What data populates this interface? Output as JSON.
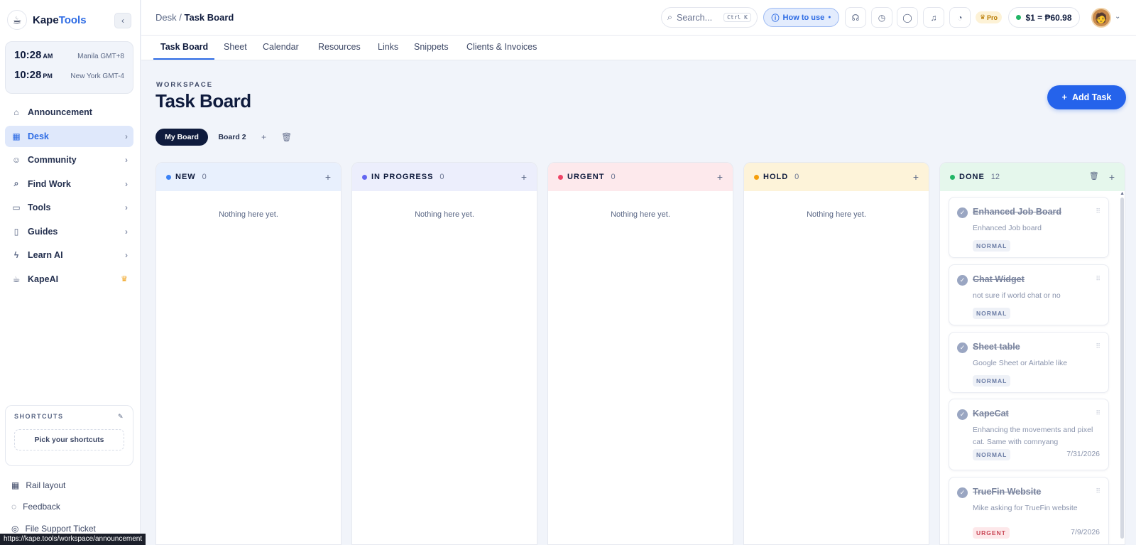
{
  "app": {
    "name_prefix": "Kape",
    "name_accent": "Tools"
  },
  "clocks": [
    {
      "time": "10:28",
      "ampm": "AM",
      "zone": "Manila GMT+8"
    },
    {
      "time": "10:28",
      "ampm": "PM",
      "zone": "New York GMT-4"
    }
  ],
  "nav": [
    {
      "label": "Announcement",
      "icon": "home-icon",
      "glyph": "⌂"
    },
    {
      "label": "Desk",
      "icon": "grid-icon",
      "glyph": "▦",
      "active": true
    },
    {
      "label": "Community",
      "icon": "users-icon",
      "glyph": "☺"
    },
    {
      "label": "Find Work",
      "icon": "search-icon",
      "glyph": "⌕"
    },
    {
      "label": "Tools",
      "icon": "briefcase-icon",
      "glyph": "▭"
    },
    {
      "label": "Guides",
      "icon": "book-icon",
      "glyph": "▯"
    },
    {
      "label": "Learn AI",
      "icon": "bolt-icon",
      "glyph": "ϟ"
    },
    {
      "label": "KapeAI",
      "icon": "cup-icon",
      "glyph": "☕"
    }
  ],
  "shortcuts": {
    "heading": "SHORTCUTS",
    "pick": "Pick your shortcuts"
  },
  "footer": {
    "rail": "Rail layout",
    "feedback": "Feedback",
    "ticket": "File Support Ticket"
  },
  "status_url": "https://kape.tools/workspace/announcement",
  "breadcrumb": {
    "parent": "Desk",
    "separator": "/",
    "current": "Task Board"
  },
  "search": {
    "placeholder": "Search...",
    "shortcut": "Ctrl K"
  },
  "howto": "How to use",
  "pro": "Pro",
  "rate": "$1 = ₱60.98",
  "tabs": [
    "Task Board",
    "Sheet",
    "Calendar",
    "Resources",
    "Links",
    "Snippets",
    "Clients & Invoices"
  ],
  "header": {
    "workspace": "WORKSPACE",
    "title": "Task Board",
    "add_task": "Add Task"
  },
  "boards": [
    "My Board",
    "Board 2"
  ],
  "columns": [
    {
      "title": "NEW",
      "count": "0",
      "color": "#3b82f6",
      "head_bg": "#e8f0fd",
      "empty": "Nothing here yet."
    },
    {
      "title": "IN PROGRESS",
      "count": "0",
      "color": "#6366f1",
      "head_bg": "#eceefc",
      "empty": "Nothing here yet."
    },
    {
      "title": "URGENT",
      "count": "0",
      "color": "#ef4466",
      "head_bg": "#fde9ec",
      "empty": "Nothing here yet."
    },
    {
      "title": "HOLD",
      "count": "0",
      "color": "#f59e0b",
      "head_bg": "#fdf3d9",
      "empty": "Nothing here yet."
    },
    {
      "title": "DONE",
      "count": "12",
      "color": "#22b566",
      "head_bg": "#e5f7ec"
    }
  ],
  "done_cards": [
    {
      "title": "Enhanced Job Board",
      "desc": "Enhanced Job board",
      "tag": "NORMAL",
      "date": ""
    },
    {
      "title": "Chat Widget",
      "desc": "not sure if world chat or no",
      "tag": "NORMAL",
      "date": ""
    },
    {
      "title": "Sheet table",
      "desc": "Google Sheet or Airtable like",
      "tag": "NORMAL",
      "date": ""
    },
    {
      "title": "KapeCat",
      "desc": "Enhancing the movements and pixel cat. Same with comnyang",
      "tag": "NORMAL",
      "date": "7/31/2026"
    },
    {
      "title": "TrueFin Website",
      "desc": "Mike asking for TrueFin website",
      "tag": "URGENT",
      "date": "7/9/2026"
    }
  ]
}
